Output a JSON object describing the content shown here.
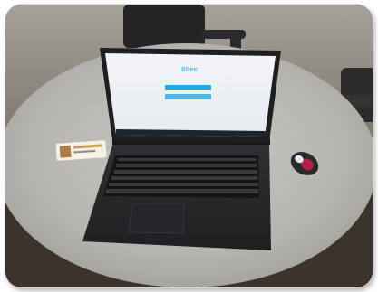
{
  "photo": {
    "subject": "laptop-on-round-table",
    "screen": {
      "brand_text": "Bfree",
      "button_one_label": "",
      "button_two_label": ""
    }
  },
  "colors": {
    "table": "#b9b8b3",
    "floor": "#3a322b",
    "wall": "#8e8a82",
    "laptop": "#2b2b2d",
    "screen_bg": "#eef1f4",
    "accent": "#23a8e0",
    "taskbar": "#1c2430"
  }
}
